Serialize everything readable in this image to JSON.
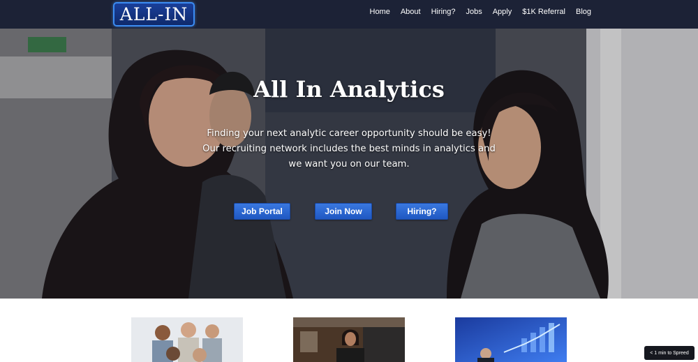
{
  "header": {
    "logo_text": "ALL-IN",
    "nav": [
      "Home",
      "About",
      "Hiring?",
      "Jobs",
      "Apply",
      "$1K Referral",
      "Blog"
    ]
  },
  "hero": {
    "title": "All In Analytics",
    "lines": [
      "Finding your next analytic career opportunity should be easy!",
      "Our recruiting network includes the best minds in analytics and",
      "we want you on our team."
    ],
    "buttons": [
      "Job Portal",
      "Join Now",
      "Hiring?"
    ]
  },
  "badge": {
    "text": "< 1 min to Spreed"
  },
  "colors": {
    "navbar_bg": "#1c2236",
    "button_blue": "#2a66d4",
    "logo_border": "#3b8cf2"
  },
  "icons": [
    "logo-mark",
    "photo-people",
    "photo-analyst",
    "photo-growth"
  ]
}
